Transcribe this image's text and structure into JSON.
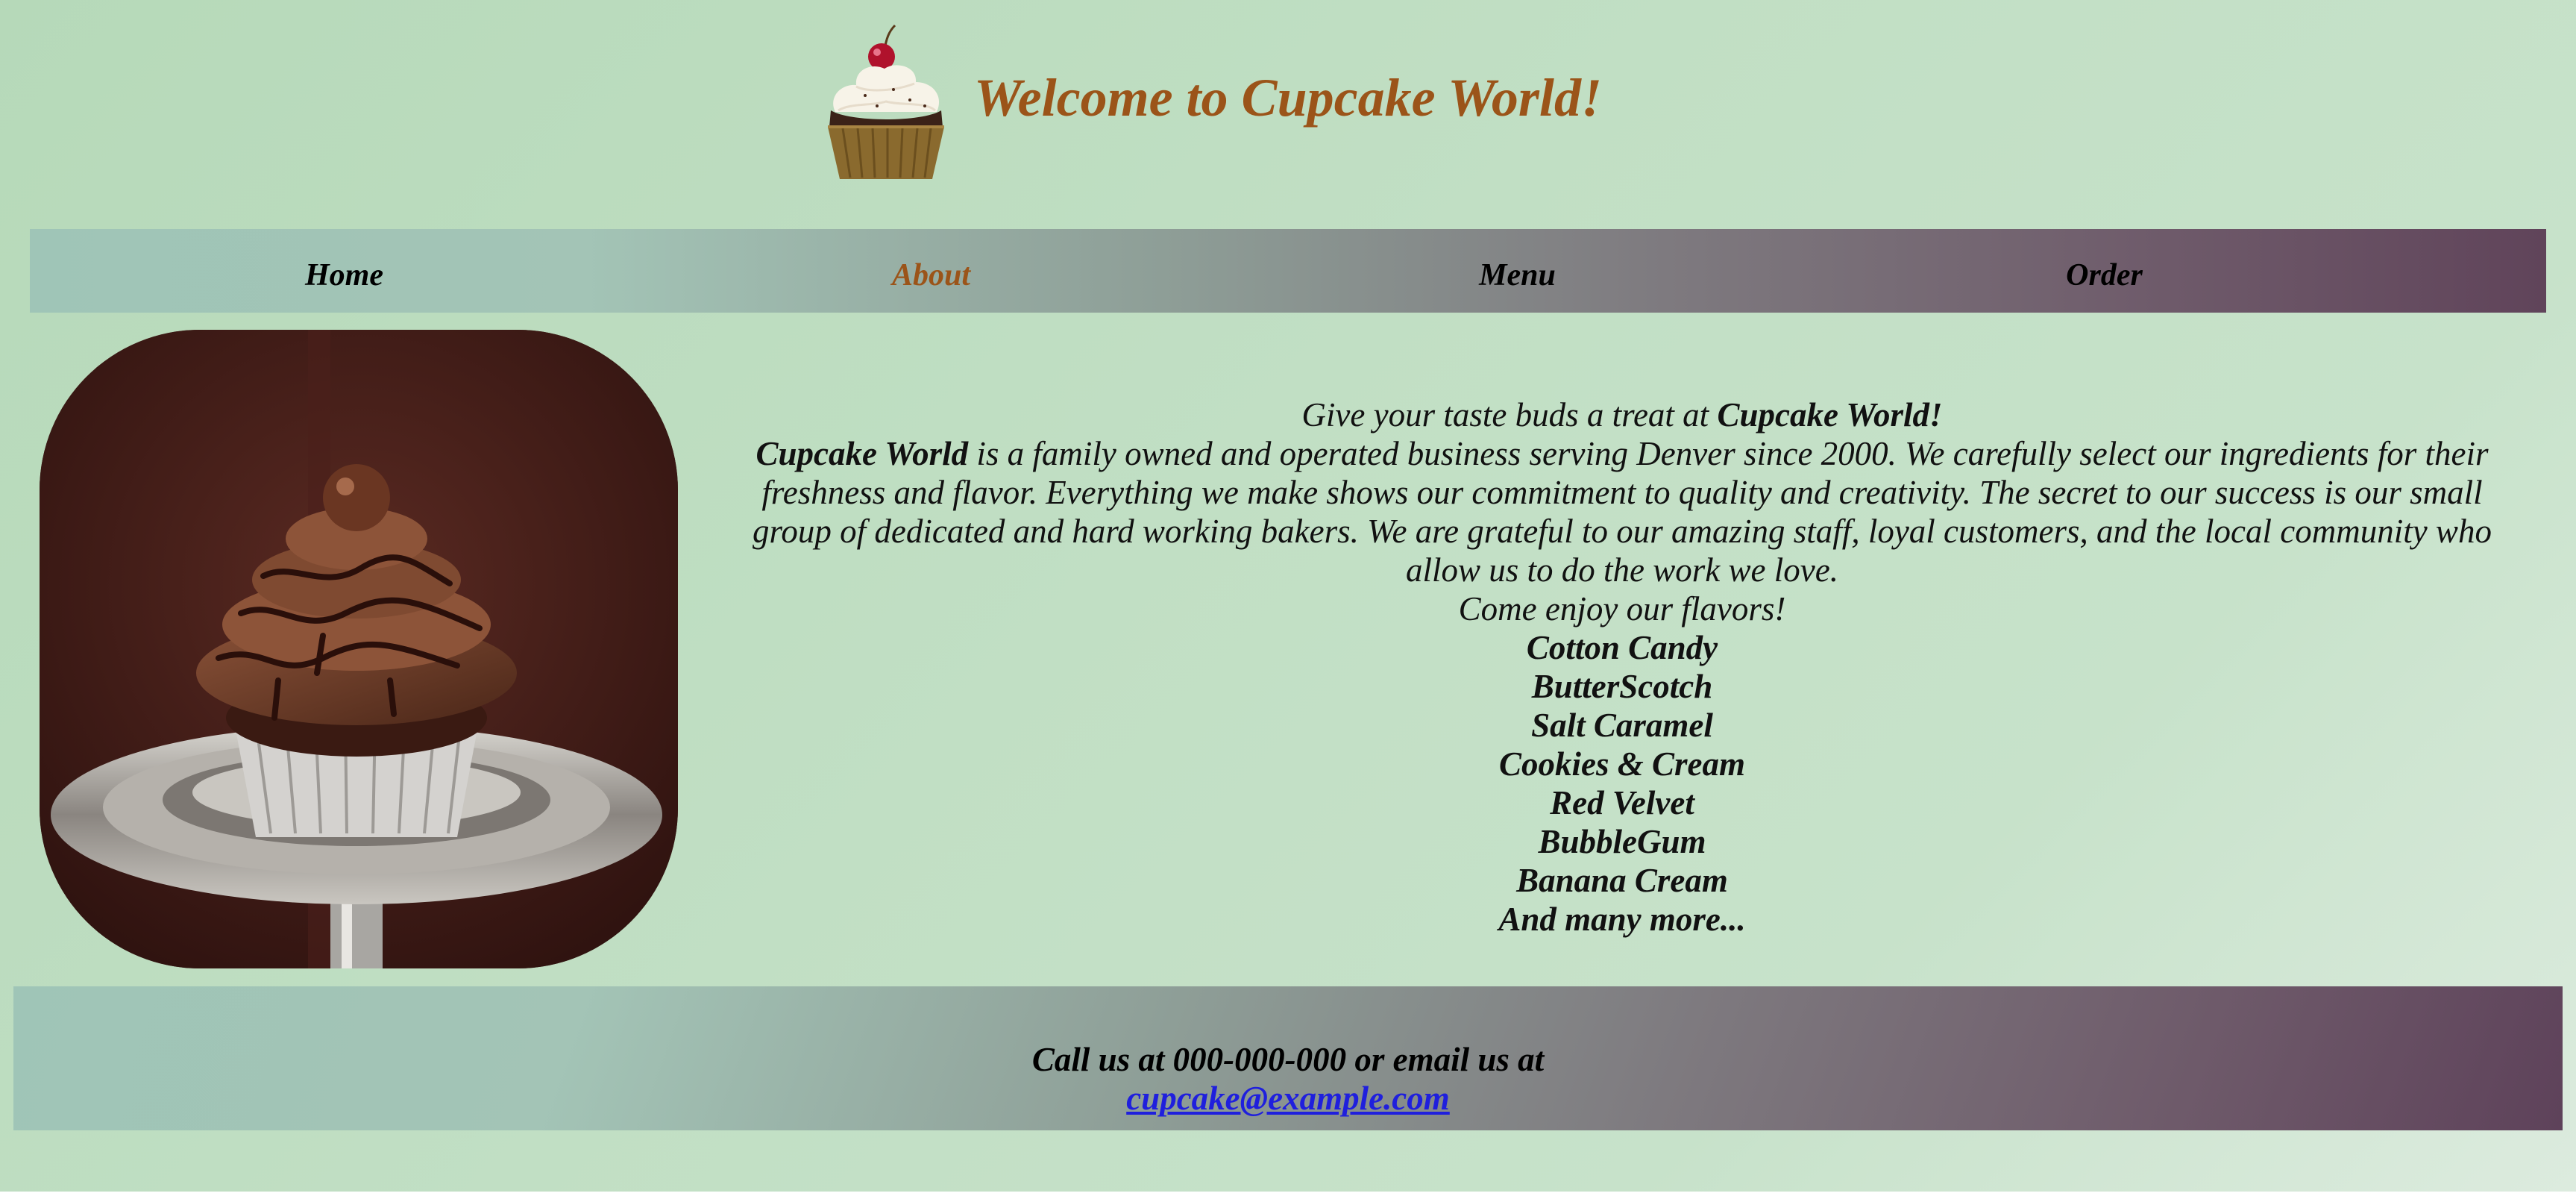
{
  "site": {
    "title": "Welcome to Cupcake World!"
  },
  "nav": {
    "items": [
      {
        "label": "Home",
        "active": false
      },
      {
        "label": "About",
        "active": true
      },
      {
        "label": "Menu",
        "active": false
      },
      {
        "label": "Order",
        "active": false
      }
    ]
  },
  "about": {
    "intro_text": "Give your taste buds a treat at ",
    "intro_brand": "Cupcake World!",
    "paragraph_brand": "Cupcake World",
    "paragraph_text": " is a family owned and operated business serving Denver since 2000. We carefully select our ingredients for their freshness and flavor. Everything we make shows our commitment to quality and creativity. The secret to our success is our small group of dedicated and hard working bakers. We are grateful to our amazing staff, loyal customers, and the local community who allow us to do the work we love.",
    "flavors_intro": "Come enjoy our flavors!",
    "flavors": [
      "Cotton Candy",
      "ButterScotch",
      "Salt Caramel",
      "Cookies & Cream",
      "Red Velvet",
      "BubbleGum",
      "Banana Cream",
      "And many more..."
    ]
  },
  "footer": {
    "contact_text": "Call us at 000-000-000 or email us at",
    "email": "cupcake@example.com"
  },
  "colors": {
    "accent": "#9b5419",
    "link": "#1f1fdd",
    "background": "#c1dfc4"
  }
}
